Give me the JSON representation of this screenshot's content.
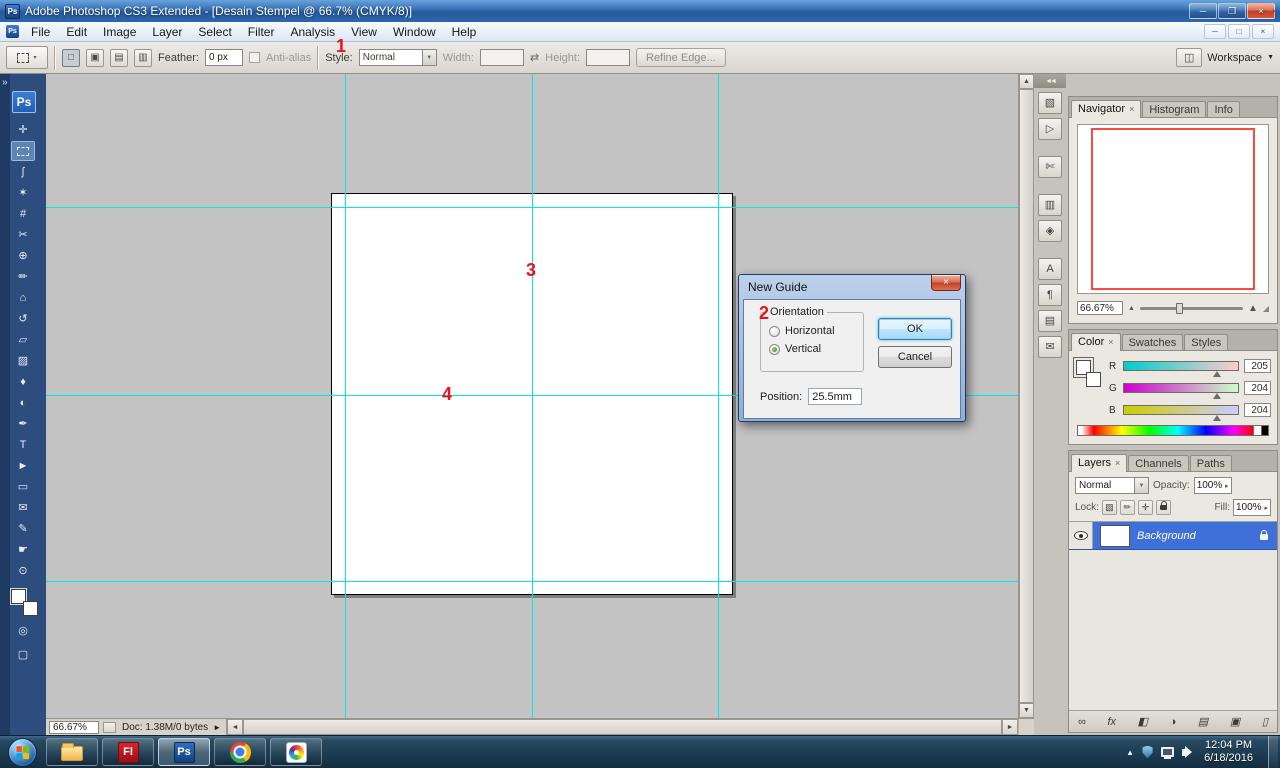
{
  "window": {
    "title": "Adobe Photoshop CS3 Extended - [Desain Stempel @ 66.7% (CMYK/8)]",
    "icon_label": "Ps",
    "controls": {
      "minimize": "─",
      "maximize": "❐",
      "close": "×"
    }
  },
  "menu": {
    "items": [
      "File",
      "Edit",
      "Image",
      "Layer",
      "Select",
      "Filter",
      "Analysis",
      "View",
      "Window",
      "Help"
    ]
  },
  "options_bar": {
    "feather_label": "Feather:",
    "feather_value": "0 px",
    "anti_alias_label": "Anti-alias",
    "style_label": "Style:",
    "style_value": "Normal",
    "width_label": "Width:",
    "height_label": "Height:",
    "refine_edge_label": "Refine Edge...",
    "workspace_label": "Workspace"
  },
  "toolbar": {
    "logo": "Ps",
    "tools": [
      {
        "name": "move-tool",
        "glyph": "✛"
      },
      {
        "name": "rectangular-marquee-tool",
        "glyph": "",
        "marquee_box": true,
        "selected": true
      },
      {
        "name": "lasso-tool",
        "glyph": "ʃ"
      },
      {
        "name": "quick-selection-tool",
        "glyph": "✶"
      },
      {
        "name": "crop-tool",
        "glyph": "#"
      },
      {
        "name": "slice-tool",
        "glyph": "✂"
      },
      {
        "name": "healing-brush-tool",
        "glyph": "⊕"
      },
      {
        "name": "brush-tool",
        "glyph": "✏"
      },
      {
        "name": "clone-stamp-tool",
        "glyph": "⌂"
      },
      {
        "name": "history-brush-tool",
        "glyph": "↺"
      },
      {
        "name": "eraser-tool",
        "glyph": "▱"
      },
      {
        "name": "gradient-tool",
        "glyph": "▨"
      },
      {
        "name": "blur-tool",
        "glyph": "♦"
      },
      {
        "name": "dodge-tool",
        "glyph": "◐"
      },
      {
        "name": "pen-tool",
        "glyph": "✒"
      },
      {
        "name": "type-tool",
        "glyph": "T"
      },
      {
        "name": "path-selection-tool",
        "glyph": "►"
      },
      {
        "name": "shape-tool",
        "glyph": "▭"
      },
      {
        "name": "notes-tool",
        "glyph": "✉"
      },
      {
        "name": "eyedropper-tool",
        "glyph": "✎"
      },
      {
        "name": "hand-tool",
        "glyph": "☛"
      },
      {
        "name": "zoom-tool",
        "glyph": "⊙"
      }
    ],
    "extra": [
      {
        "name": "quick-mask-button",
        "glyph": "◎"
      },
      {
        "name": "screen-mode-button",
        "glyph": "▢"
      }
    ]
  },
  "dock": {
    "icons": [
      {
        "name": "brushes",
        "glyph": "▧"
      },
      {
        "name": "tool-presets",
        "glyph": "▷"
      },
      {
        "name": "clone-source",
        "glyph": "✄",
        "gap": true
      },
      {
        "name": "histogram",
        "glyph": "▥",
        "gap": true
      },
      {
        "name": "info",
        "glyph": "◈"
      },
      {
        "name": "character",
        "glyph": "A",
        "gap": true
      },
      {
        "name": "paragraph",
        "glyph": "¶"
      },
      {
        "name": "layer-comps",
        "glyph": "▤"
      },
      {
        "name": "notes",
        "glyph": "✉"
      }
    ]
  },
  "annotations": {
    "n1": "1",
    "n2": "2",
    "n3": "3",
    "n4": "4"
  },
  "dialog": {
    "title": "New Guide",
    "orientation_label": "Orientation",
    "options": [
      "Horizontal",
      "Vertical"
    ],
    "selected_option": "Vertical",
    "position_label": "Position:",
    "position_value": "25.5mm",
    "ok_label": "OK",
    "cancel_label": "Cancel"
  },
  "panels": {
    "navigator": {
      "tabs": [
        "Navigator",
        "Histogram",
        "Info"
      ],
      "active_tab": "Navigator",
      "zoom_value": "66.67%"
    },
    "color": {
      "tabs": [
        "Color",
        "Swatches",
        "Styles"
      ],
      "active_tab": "Color",
      "channels": [
        {
          "label": "R",
          "value": "205"
        },
        {
          "label": "G",
          "value": "204"
        },
        {
          "label": "B",
          "value": "204"
        }
      ]
    },
    "layers": {
      "tabs": [
        "Layers",
        "Channels",
        "Paths"
      ],
      "active_tab": "Layers",
      "blend_mode": "Normal",
      "opacity_label": "Opacity:",
      "opacity_value": "100%",
      "lock_label": "Lock:",
      "fill_label": "Fill:",
      "fill_value": "100%",
      "layer_name": "Background",
      "lock_icons": [
        {
          "name": "lock-transparency",
          "glyph": "▨"
        },
        {
          "name": "lock-image-pixels",
          "glyph": "✏"
        },
        {
          "name": "lock-position",
          "glyph": "✛"
        },
        {
          "name": "lock-all",
          "glyph": "__lock"
        }
      ],
      "footer_icons": [
        {
          "name": "link-layers",
          "glyph": "∞"
        },
        {
          "name": "layer-style",
          "glyph": "fx"
        },
        {
          "name": "add-layer-mask",
          "glyph": "◧"
        },
        {
          "name": "new-adjustment-layer",
          "glyph": "◑"
        },
        {
          "name": "new-group",
          "glyph": "▤"
        },
        {
          "name": "new-layer",
          "glyph": "▣"
        },
        {
          "name": "delete-layer",
          "glyph": "▯"
        }
      ]
    }
  },
  "status_bar": {
    "zoom": "66.67%",
    "doc_info": "Doc: 1.38M/0 bytes"
  },
  "taskbar": {
    "flash_label": "Fl",
    "photoshop_label": "Ps",
    "clock_time": "12:04 PM",
    "clock_date": "6/18/2016"
  },
  "icons": {
    "window_minimize": "─",
    "window_maximize": "❐",
    "window_close": "×",
    "doc_minimize": "─",
    "doc_restore": "□",
    "doc_close": "×",
    "chevron_expand": "»",
    "dock_collapse": "◄◄",
    "dropdown_arrow": "▼",
    "small_arrow": "▾",
    "spin_arrow": "▸",
    "swap_arrow": "⇄",
    "flyout_arrow": "►",
    "scroll_up": "▲",
    "scroll_down": "▼",
    "scroll_left": "◄",
    "scroll_right": "►",
    "zoom_out_mountain": "▲",
    "zoom_in_mountain": "▲",
    "resize_corner": "◢",
    "panel_minimize": "−",
    "panel_close": "×",
    "tray_up_arrow": "▲",
    "workspace_icon": "◫",
    "dialog_close": "×"
  },
  "colors": {
    "guide_cyan": "#00e8e8",
    "annotation_red": "#e4151b",
    "selected_layer_blue": "#3f6fd8",
    "titlebar_blue": "#2f66ab"
  }
}
